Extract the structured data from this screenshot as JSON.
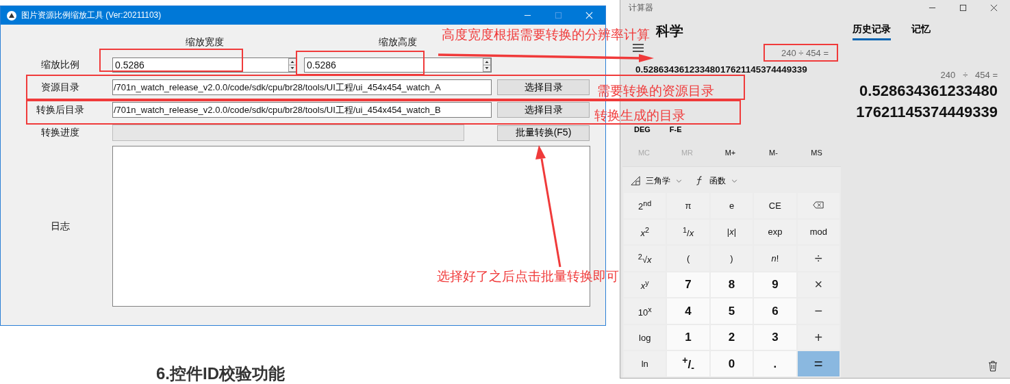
{
  "tool_window": {
    "title": "图片资源比例缩放工具 (Ver:20211103)",
    "scale_headers": [
      "缩放宽度",
      "缩放高度"
    ],
    "scale": {
      "label": "缩放比例",
      "width_value": "0.5286",
      "height_value": "0.5286"
    },
    "dirs": [
      {
        "label": "资源目录",
        "value": "/701n_watch_release_v2.0.0/code/sdk/cpu/br28/tools/UI工程/ui_454x454_watch_A",
        "button": "选择目录"
      },
      {
        "label": "转换后目录",
        "value": "/701n_watch_release_v2.0.0/code/sdk/cpu/br28/tools/UI工程/ui_454x454_watch_B",
        "button": "选择目录"
      }
    ],
    "progress": {
      "label": "转换进度",
      "level": 0,
      "button": "批量转换(F5)"
    },
    "log": {
      "label": "日志"
    }
  },
  "page_heading": "6.控件ID校验功能",
  "calculator": {
    "title": "计算器",
    "mode": "科学",
    "expression": "240 ÷ 454 =",
    "result": "0.52863436123348017621145374449339",
    "mode_toggles": [
      "DEG",
      "F-E"
    ],
    "memory": [
      {
        "label": "MC",
        "disabled": true
      },
      {
        "label": "MR",
        "disabled": true
      },
      {
        "label": "M+",
        "disabled": false
      },
      {
        "label": "M-",
        "disabled": false
      },
      {
        "label": "MS",
        "disabled": false
      }
    ],
    "dropdowns": [
      {
        "kind": "trig",
        "label": "三角学"
      },
      {
        "kind": "function",
        "label": "函数"
      }
    ],
    "keys": [
      {
        "kind": "function",
        "label": "2$^{nd}$"
      },
      {
        "kind": "function",
        "label": "π"
      },
      {
        "kind": "function",
        "label": "e"
      },
      {
        "kind": "function",
        "label": "CE"
      },
      {
        "kind": "backspace"
      },
      {
        "kind": "function",
        "label": "*x*$^{2}$"
      },
      {
        "kind": "function",
        "label": "$^{1}$/*x*"
      },
      {
        "kind": "function",
        "label": "|*x*|"
      },
      {
        "kind": "function",
        "label": "exp"
      },
      {
        "kind": "function",
        "label": "mod"
      },
      {
        "kind": "function",
        "label": "$^{2}$√*x*"
      },
      {
        "kind": "function",
        "label": "("
      },
      {
        "kind": "function",
        "label": ")"
      },
      {
        "kind": "function",
        "label": "*n*!"
      },
      {
        "kind": "operator",
        "label": "÷"
      },
      {
        "kind": "function",
        "label": "*x*$^{y}$"
      },
      {
        "kind": "digit",
        "label": "7"
      },
      {
        "kind": "digit",
        "label": "8"
      },
      {
        "kind": "digit",
        "label": "9"
      },
      {
        "kind": "operator",
        "label": "×"
      },
      {
        "kind": "function",
        "label": "10$^{x}$"
      },
      {
        "kind": "digit",
        "label": "4"
      },
      {
        "kind": "digit",
        "label": "5"
      },
      {
        "kind": "digit",
        "label": "6"
      },
      {
        "kind": "operator",
        "label": "−"
      },
      {
        "kind": "function",
        "label": "log"
      },
      {
        "kind": "digit",
        "label": "1"
      },
      {
        "kind": "digit",
        "label": "2"
      },
      {
        "kind": "digit",
        "label": "3"
      },
      {
        "kind": "operator",
        "label": "+"
      },
      {
        "kind": "function",
        "label": "ln"
      },
      {
        "kind": "digit",
        "label": "$^{+}$/$_{-}$"
      },
      {
        "kind": "digit",
        "label": "0"
      },
      {
        "kind": "digit",
        "label": "."
      },
      {
        "kind": "equals",
        "label": "="
      }
    ],
    "history_tabs": [
      {
        "label": "历史记录",
        "selected": true
      },
      {
        "label": "记忆",
        "selected": false
      }
    ],
    "history": [
      {
        "expression": "240   ÷   454 =",
        "result_lines": [
          "0.528634361233480",
          "17621145374449339"
        ]
      }
    ]
  },
  "annotations": [
    {
      "text": "高度宽度根据需要转换的分辨率计算"
    },
    {
      "text": "需要转换的资源目录"
    },
    {
      "text": "转换生成的目录"
    },
    {
      "text": "选择好了之后点击批量转换即可"
    }
  ]
}
